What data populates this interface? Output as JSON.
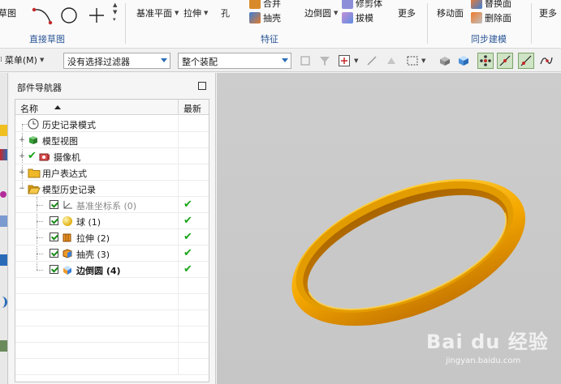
{
  "ribbon": {
    "sketch_group": {
      "cut_label": "草图",
      "label": "直接草图"
    },
    "feature_group": {
      "datum_plane": "基准平面",
      "extrude": "拉伸",
      "hole": "孔",
      "unite": "合并",
      "shell": "抽壳",
      "edge_blend": "边倒圆",
      "trim_body": "修剪体",
      "draft": "拔模",
      "more": "更多",
      "label": "特征"
    },
    "sync_group": {
      "move_face": "移动面",
      "replace_face": "替换面",
      "delete_face": "删除面",
      "label": "同步建模"
    },
    "more_right": "更多"
  },
  "toolbar": {
    "menu_label": "菜单(M)",
    "filter_value": "没有选择过滤器",
    "assembly_value": "整个装配"
  },
  "navigator": {
    "title": "部件导航器",
    "col_name": "名称",
    "col_latest": "最新",
    "items": [
      {
        "label": "历史记录模式",
        "icon": "clock-icon",
        "level": 0,
        "expander": "",
        "checkbox": false,
        "check": false,
        "latest": false,
        "bold": false,
        "gray": false
      },
      {
        "label": "模型视图",
        "icon": "model-view-icon",
        "level": 0,
        "expander": "+",
        "checkbox": false,
        "check": false,
        "latest": false,
        "bold": false,
        "gray": false
      },
      {
        "label": "摄像机",
        "icon": "camera-icon",
        "level": 0,
        "expander": "+",
        "checkbox": false,
        "check": true,
        "latest": false,
        "bold": false,
        "gray": false
      },
      {
        "label": "用户表达式",
        "icon": "folder-icon",
        "level": 0,
        "expander": "+",
        "checkbox": false,
        "check": false,
        "latest": false,
        "bold": false,
        "gray": false
      },
      {
        "label": "模型历史记录",
        "icon": "folder-open-icon",
        "level": 0,
        "expander": "−",
        "checkbox": false,
        "check": false,
        "latest": false,
        "bold": false,
        "gray": false
      },
      {
        "label": "基准坐标系 (0)",
        "icon": "datum-csys-icon",
        "level": 1,
        "expander": "",
        "checkbox": true,
        "check": false,
        "latest": true,
        "bold": false,
        "gray": true
      },
      {
        "label": "球 (1)",
        "icon": "sphere-icon",
        "level": 1,
        "expander": "",
        "checkbox": true,
        "check": false,
        "latest": true,
        "bold": false,
        "gray": false
      },
      {
        "label": "拉伸 (2)",
        "icon": "extrude-icon",
        "level": 1,
        "expander": "",
        "checkbox": true,
        "check": false,
        "latest": true,
        "bold": false,
        "gray": false
      },
      {
        "label": "抽壳 (3)",
        "icon": "shell-icon",
        "level": 1,
        "expander": "",
        "checkbox": true,
        "check": false,
        "latest": true,
        "bold": false,
        "gray": false
      },
      {
        "label": "边倒圆 (4)",
        "icon": "edge-blend-icon",
        "level": 1,
        "expander": "",
        "checkbox": true,
        "check": false,
        "latest": true,
        "bold": true,
        "gray": false
      }
    ]
  },
  "viewport": {
    "model_color": "#f5a800",
    "background": "#c9c9c9",
    "watermark": "Bai du 经验",
    "watermark_url": "jingyan.baidu.com"
  },
  "colors": {
    "accent": "#2b5797",
    "check_green": "#18a518",
    "folder_yellow": "#f0b828"
  }
}
